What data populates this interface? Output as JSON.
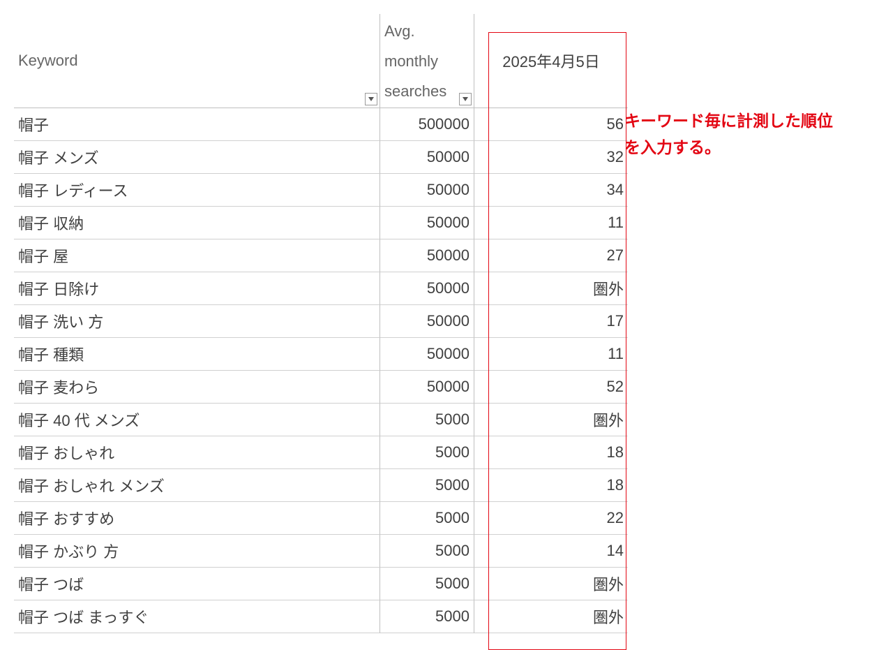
{
  "header": {
    "keyword": "Keyword",
    "searches": "Avg.\nmonthly\nsearches",
    "date": "2025年4月5日"
  },
  "rows": [
    {
      "keyword": "帽子",
      "searches": "500000",
      "rank": "56"
    },
    {
      "keyword": "帽子 メンズ",
      "searches": "50000",
      "rank": "32"
    },
    {
      "keyword": "帽子 レディース",
      "searches": "50000",
      "rank": "34"
    },
    {
      "keyword": "帽子 収納",
      "searches": "50000",
      "rank": "11"
    },
    {
      "keyword": "帽子 屋",
      "searches": "50000",
      "rank": "27"
    },
    {
      "keyword": "帽子 日除け",
      "searches": "50000",
      "rank": "圏外"
    },
    {
      "keyword": "帽子 洗い 方",
      "searches": "50000",
      "rank": "17"
    },
    {
      "keyword": "帽子 種類",
      "searches": "50000",
      "rank": "11"
    },
    {
      "keyword": "帽子 麦わら",
      "searches": "50000",
      "rank": "52"
    },
    {
      "keyword": "帽子 40 代 メンズ",
      "searches": "5000",
      "rank": "圏外"
    },
    {
      "keyword": "帽子 おしゃれ",
      "searches": "5000",
      "rank": "18"
    },
    {
      "keyword": "帽子 おしゃれ メンズ",
      "searches": "5000",
      "rank": "18"
    },
    {
      "keyword": "帽子 おすすめ",
      "searches": "5000",
      "rank": "22"
    },
    {
      "keyword": "帽子 かぶり 方",
      "searches": "5000",
      "rank": "14"
    },
    {
      "keyword": "帽子 つば",
      "searches": "5000",
      "rank": "圏外"
    },
    {
      "keyword": "帽子 つば まっすぐ",
      "searches": "5000",
      "rank": "圏外"
    }
  ],
  "annotation": "キーワード毎に計測した順位を入力する。"
}
